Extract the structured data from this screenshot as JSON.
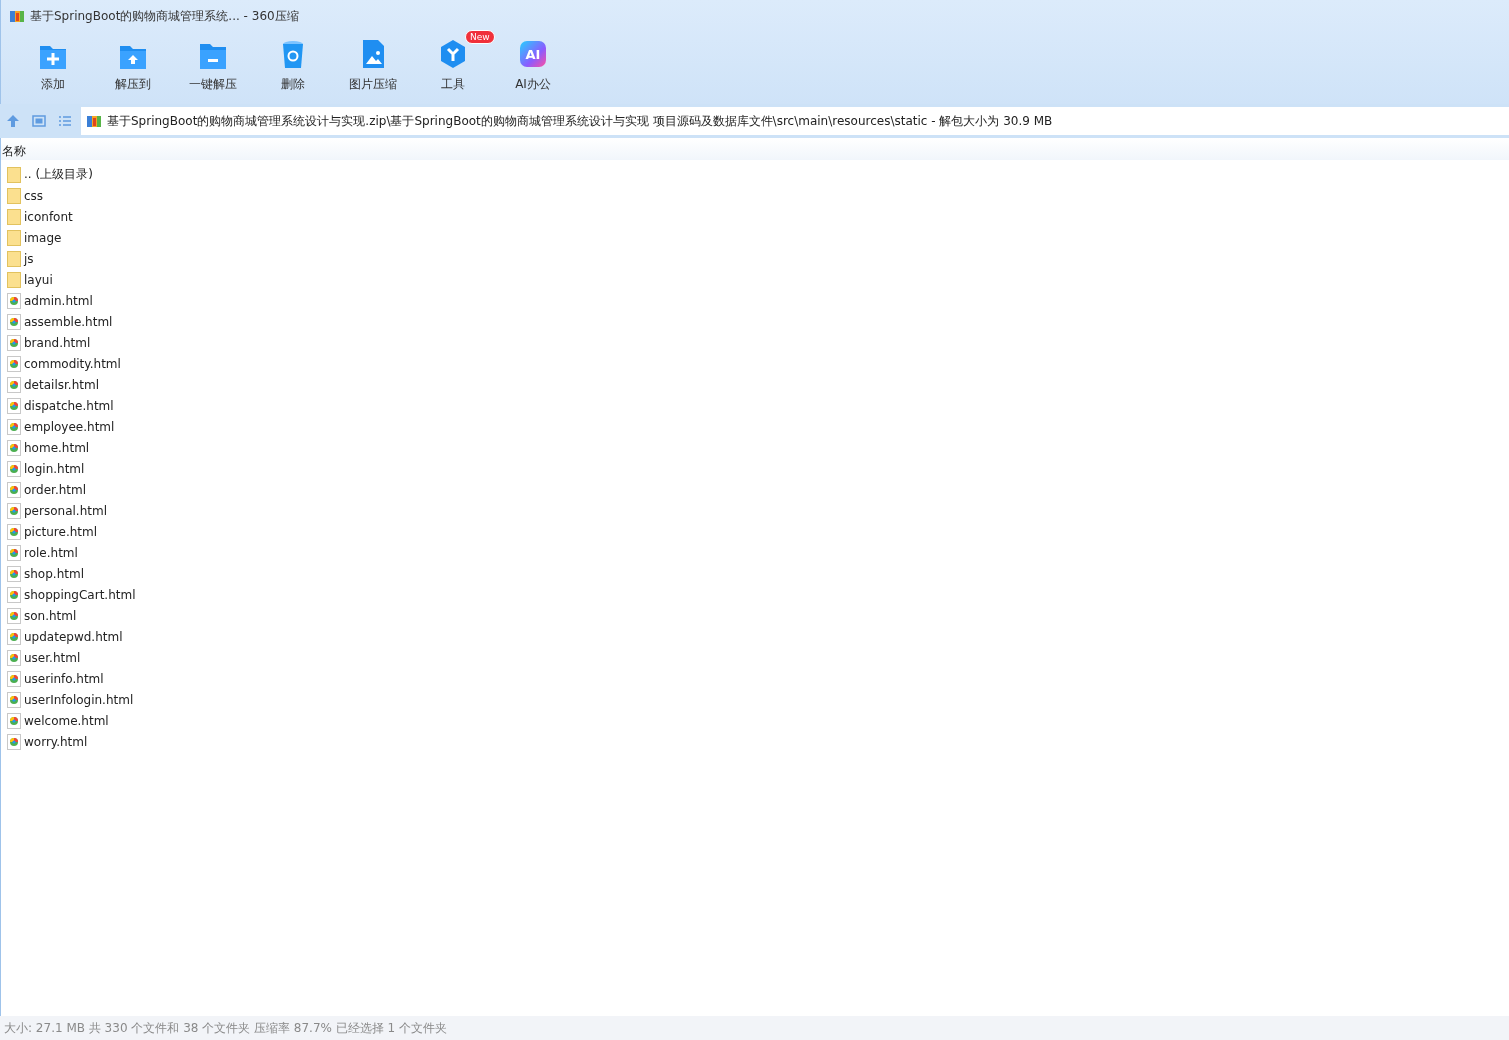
{
  "window": {
    "title": "基于SpringBoot的购物商城管理系统... - 360压缩"
  },
  "toolbar": [
    {
      "label": "添加",
      "kind": "add"
    },
    {
      "label": "解压到",
      "kind": "extract"
    },
    {
      "label": "一键解压",
      "kind": "oneclick"
    },
    {
      "label": "删除",
      "kind": "delete"
    },
    {
      "label": "图片压缩",
      "kind": "image"
    },
    {
      "label": "工具",
      "kind": "tools",
      "badge": "New"
    },
    {
      "label": "AI办公",
      "kind": "ai",
      "icon_text": "AI"
    }
  ],
  "address_bar": {
    "path": "基于SpringBoot的购物商城管理系统设计与实现.zip\\基于SpringBoot的购物商城管理系统设计与实现 项目源码及数据库文件\\src\\main\\resources\\static - 解包大小为 30.9 MB"
  },
  "file_list": {
    "columns": [
      "名称"
    ],
    "rows": [
      {
        "name": ".. (上级目录)",
        "kind": "folder"
      },
      {
        "name": "css",
        "kind": "folder"
      },
      {
        "name": "iconfont",
        "kind": "folder"
      },
      {
        "name": "image",
        "kind": "folder"
      },
      {
        "name": "js",
        "kind": "folder"
      },
      {
        "name": "layui",
        "kind": "folder"
      },
      {
        "name": "admin.html",
        "kind": "html"
      },
      {
        "name": "assemble.html",
        "kind": "html"
      },
      {
        "name": "brand.html",
        "kind": "html"
      },
      {
        "name": "commodity.html",
        "kind": "html"
      },
      {
        "name": "detailsr.html",
        "kind": "html"
      },
      {
        "name": "dispatche.html",
        "kind": "html"
      },
      {
        "name": "employee.html",
        "kind": "html"
      },
      {
        "name": "home.html",
        "kind": "html"
      },
      {
        "name": "login.html",
        "kind": "html"
      },
      {
        "name": "order.html",
        "kind": "html"
      },
      {
        "name": "personal.html",
        "kind": "html"
      },
      {
        "name": "picture.html",
        "kind": "html"
      },
      {
        "name": "role.html",
        "kind": "html"
      },
      {
        "name": "shop.html",
        "kind": "html"
      },
      {
        "name": "shoppingCart.html",
        "kind": "html"
      },
      {
        "name": "son.html",
        "kind": "html"
      },
      {
        "name": "updatepwd.html",
        "kind": "html"
      },
      {
        "name": "user.html",
        "kind": "html"
      },
      {
        "name": "userinfo.html",
        "kind": "html"
      },
      {
        "name": "userInfologin.html",
        "kind": "html"
      },
      {
        "name": "welcome.html",
        "kind": "html"
      },
      {
        "name": "worry.html",
        "kind": "html"
      }
    ]
  },
  "status_bar": "大小: 27.1 MB 共 330 个文件和 38 个文件夹 压缩率 87.7% 已经选择 1 个文件夹"
}
